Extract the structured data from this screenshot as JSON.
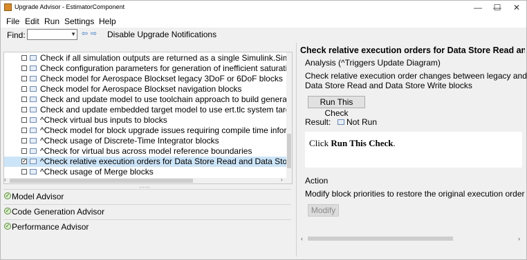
{
  "window": {
    "title": "Upgrade Advisor - EstimatorComponent"
  },
  "window_controls": {
    "minimize": "—",
    "maximize": "☐",
    "close": "✕"
  },
  "menu": [
    "File",
    "Edit",
    "Run",
    "Settings",
    "Help"
  ],
  "toolbar": {
    "find_label": "Find:",
    "find_value": "",
    "prev_glyph": "⇦",
    "next_glyph": "⇨",
    "disable_label": "Disable Upgrade Notifications"
  },
  "checks": [
    {
      "label": "Check if all simulation outputs are returned as a single Simulink.Simulat",
      "checked": false,
      "selected": false
    },
    {
      "label": "Check configuration parameters for generation of inefficient saturation c",
      "checked": false,
      "selected": false
    },
    {
      "label": "Check model for Aerospace Blockset legacy 3DoF or 6DoF blocks",
      "checked": false,
      "selected": false
    },
    {
      "label": "Check model for Aerospace Blockset navigation blocks",
      "checked": false,
      "selected": false
    },
    {
      "label": "Check and update model to use toolchain approach to build generated c",
      "checked": false,
      "selected": false
    },
    {
      "label": "Check and update embedded target model to use ert.tlc system target w",
      "checked": false,
      "selected": false
    },
    {
      "label": "^Check virtual bus inputs to blocks",
      "checked": false,
      "selected": false
    },
    {
      "label": "^Check model for block upgrade issues requiring compile time informat",
      "checked": false,
      "selected": false
    },
    {
      "label": "^Check usage of Discrete-Time Integrator blocks",
      "checked": false,
      "selected": false
    },
    {
      "label": "^Check for virtual bus across model reference boundaries",
      "checked": false,
      "selected": false
    },
    {
      "label": "^Check relative execution orders for Data Store Read and Data Store W",
      "checked": true,
      "selected": true
    },
    {
      "label": "^Check usage of Merge blocks",
      "checked": false,
      "selected": false
    }
  ],
  "advisors": [
    "Model Advisor",
    "Code Generation Advisor",
    "Performance Advisor"
  ],
  "detail": {
    "title": "Check relative execution orders for Data Store Read and",
    "analysis_heading": "Analysis (^Triggers Update Diagram)",
    "description_line1": "Check relative execution order changes between legacy and ta",
    "description_line2": "Data Store Read and Data Store Write blocks",
    "run_button": "Run This Check",
    "result_label": "Result:",
    "result_value": "Not Run",
    "result_box_prefix": "Click ",
    "result_box_bold": "Run This Check",
    "result_box_suffix": ".",
    "action_heading": "Action",
    "action_text": "Modify block priorities to restore the original execution order",
    "modify_button": "Modify"
  },
  "colors": {
    "selection": "#cce4f7",
    "accent": "#3a78c4"
  }
}
